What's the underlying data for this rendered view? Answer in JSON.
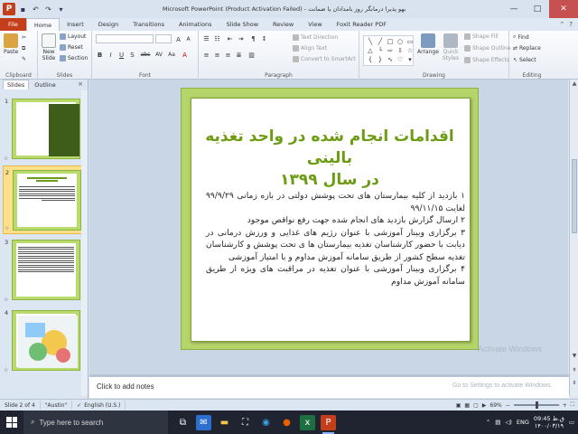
{
  "window": {
    "title": "Microsoft PowerPoint (Product Activation Failed) - بهو پذیرا درمانگر روز بامدادان یا ضمانت",
    "app_letter": "P",
    "minimize": "—",
    "maximize": "□",
    "close": "✕"
  },
  "tabs": {
    "file": "File",
    "items": [
      "Home",
      "Insert",
      "Design",
      "Transitions",
      "Animations",
      "Slide Show",
      "Review",
      "View",
      "Foxit Reader PDF"
    ]
  },
  "ribbon": {
    "clipboard": {
      "paste": "Paste",
      "label": "Clipboard"
    },
    "slides": {
      "new_slide": "New Slide",
      "layout": "Layout",
      "reset": "Reset",
      "section": "Section",
      "label": "Slides"
    },
    "font": {
      "label": "Font",
      "buttons": [
        "B",
        "I",
        "U",
        "S",
        "abc",
        "AV",
        "Aa",
        "A"
      ]
    },
    "paragraph": {
      "text_direction": "Text Direction",
      "align_text": "Align Text",
      "smartart": "Convert to SmartArt",
      "label": "Paragraph"
    },
    "drawing": {
      "arrange": "Arrange",
      "quick_styles": "Quick Styles",
      "shape_fill": "Shape Fill",
      "shape_outline": "Shape Outline",
      "shape_effects": "Shape Effects",
      "label": "Drawing"
    },
    "editing": {
      "find": "Find",
      "replace": "Replace",
      "select": "Select",
      "label": "Editing"
    }
  },
  "left_pane": {
    "tabs": [
      "Slides",
      "Outline"
    ],
    "close": "×",
    "slide_numbers": [
      "1",
      "2",
      "3",
      "4"
    ]
  },
  "slide": {
    "title_line1": "اقدامات انجام شده در واحد تغذیه بالینی",
    "title_line2": "در سال ۱۳۹۹",
    "items": [
      "۱ بازدید از کلیه بیمارستان های تحت پوشش دولتی در بازه زمانی ۹۹/۹/۲۹ لغایت ۹۹/۱۱/۱۵",
      "۲ ارسال گزارش بازدید های انجام شده جهت رفع نواقص موجود",
      "۳ برگزاری وبینار آموزشی با عنوان رژیم های غذایی و ورزش درمانی در دیابت با حضور کارشناسان تغذیه بیمارستان ها ی تحت پوشش و کارشناسان تغذیه سطح کشور از طریق سامانه آموزش مداوم و با امتیاز آموزشی",
      "۴ برگزاری وبینار آموزشی با عنوان تغذیه در مراقبت های ویژه از طریق سامانه آموزش مداوم"
    ]
  },
  "notes": {
    "placeholder": "Click to add notes",
    "activate_title": "Activate Windows",
    "activate_sub": "Go to Settings to activate Windows."
  },
  "status": {
    "slide_of": "Slide 2 of 4",
    "theme": "\"Austin\"",
    "language": "English (U.S.)",
    "zoom": "69%"
  },
  "taskbar": {
    "search_placeholder": "Type here to search",
    "language": "ENG",
    "time": "ق.ظ 09:45",
    "date": "۱۴۰۰/۰۳/۱۹"
  }
}
